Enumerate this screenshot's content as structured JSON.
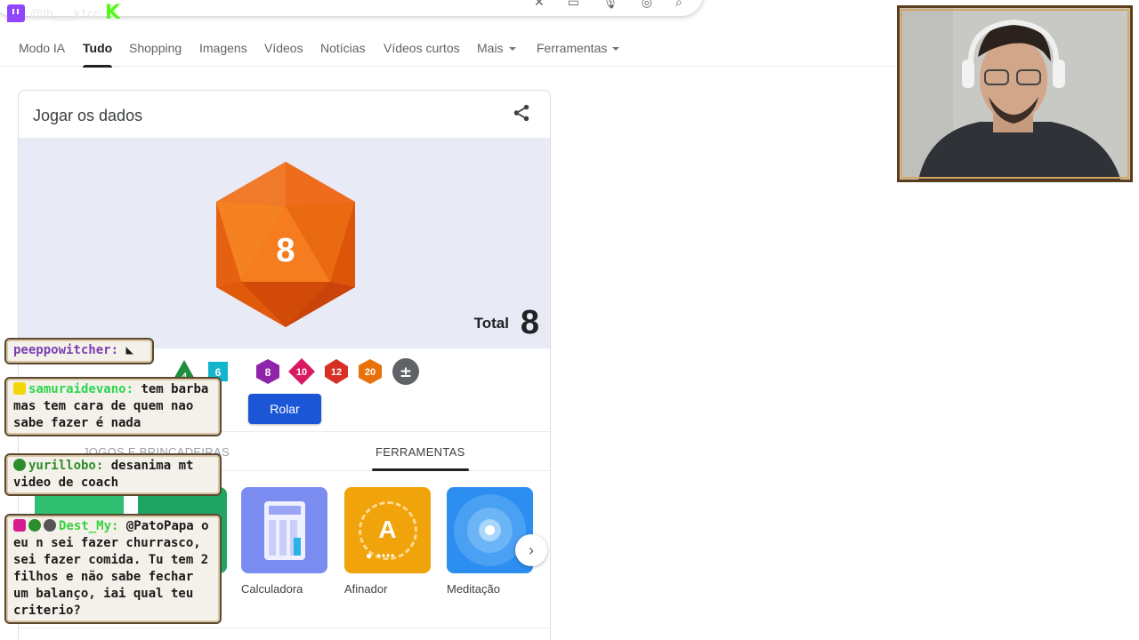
{
  "overlay": {
    "logos": [
      "twitch-logo",
      "kick-logo"
    ],
    "faded_text": "@th___k1cc"
  },
  "search": {
    "icons": [
      "close-icon",
      "keyboard-icon",
      "mic-icon",
      "lens-icon",
      "search-icon"
    ]
  },
  "tabs": [
    {
      "label": "Modo IA"
    },
    {
      "label": "Tudo",
      "active": true
    },
    {
      "label": "Shopping"
    },
    {
      "label": "Imagens"
    },
    {
      "label": "Vídeos"
    },
    {
      "label": "Notícias"
    },
    {
      "label": "Vídeos curtos"
    },
    {
      "label": "Mais",
      "dropdown": true
    },
    {
      "label": "Ferramentas",
      "dropdown": true
    }
  ],
  "card": {
    "title": "Jogar os dados",
    "die_face": "8",
    "total_label": "Total",
    "total_value": "8",
    "dice": [
      {
        "label": "4",
        "color": "#1e8e3e"
      },
      {
        "label": "6",
        "color": "#12b5cb"
      },
      {
        "label": "8",
        "color": "#8e24aa"
      },
      {
        "label": "10",
        "color": "#d81b60"
      },
      {
        "label": "12",
        "color": "#d93025"
      },
      {
        "label": "20",
        "color": "#e8710a"
      },
      {
        "label": "±",
        "color": "#5f6368"
      }
    ],
    "roll_label": "Rolar",
    "sections": {
      "games": "JOGOS E BRINCADEIRAS",
      "tools": "FERRAMENTAS"
    },
    "tools": [
      {
        "label": "Calculadora",
        "icon": "calculator-icon"
      },
      {
        "label": "Afinador",
        "icon": "tuner-icon",
        "letter": "A"
      },
      {
        "label": "Meditação",
        "icon": "meditation-icon"
      }
    ]
  },
  "chat": [
    {
      "user": "peeppowitcher:",
      "user_color": "#7b3fb5",
      "text": ""
    },
    {
      "user": "samuraidevano:",
      "user_color": "#2bd64f",
      "text": "tem barba mas tem cara de quem nao sabe fazer é nada"
    },
    {
      "user": "yurillobo:",
      "user_color": "#2c8d2c",
      "text": "desanima mt video de coach"
    },
    {
      "user": "Dest_My:",
      "user_color": "#38d23f",
      "text": "@PatoPapa o eu n sei fazer churrasco, sei fazer comida. Tu tem 2 filhos e não sabe fechar um balanço, iai qual teu criterio?"
    }
  ],
  "colors": {
    "accent_blue": "#1a56d6",
    "dice_bg": "#e8eaf6",
    "d20_orange": "#e8590c"
  }
}
